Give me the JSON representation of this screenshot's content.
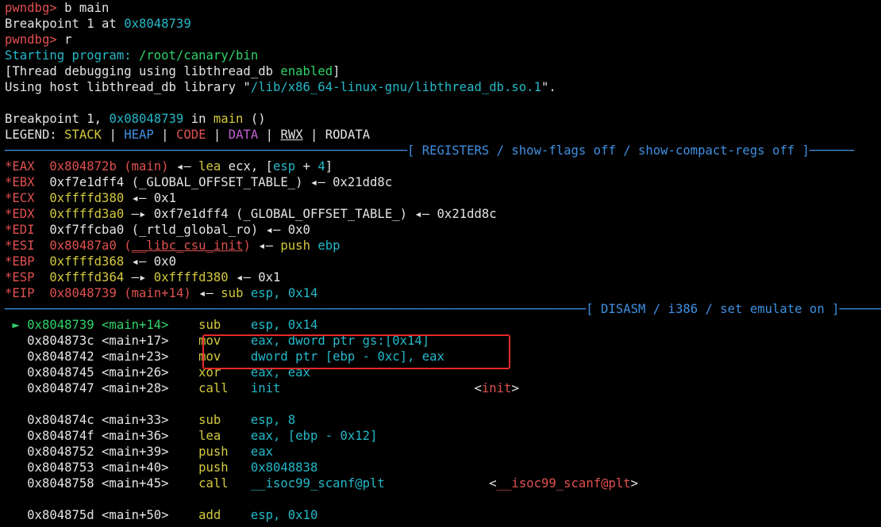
{
  "colors": {
    "background": "#000000",
    "prompt": "#e05050",
    "address": "#24b8c8",
    "code": "#d4c93e",
    "highlight_box": "#e6282a"
  },
  "lines": [
    [
      {
        "t": "pwndbg> ",
        "c": "red"
      },
      {
        "t": "b main",
        "c": "white"
      }
    ],
    [
      {
        "t": "Breakpoint 1 at ",
        "c": "white"
      },
      {
        "t": "0x8048739",
        "c": "cyan"
      }
    ],
    [
      {
        "t": "pwndbg> ",
        "c": "red"
      },
      {
        "t": "r",
        "c": "white"
      }
    ],
    [
      {
        "t": "Starting program: ",
        "c": "cyan"
      },
      {
        "t": "/root/canary/bin",
        "c": "green"
      }
    ],
    [
      {
        "t": "[Thread debugging using libthread_db ",
        "c": "white"
      },
      {
        "t": "enabled",
        "c": "green"
      },
      {
        "t": "]",
        "c": "white"
      }
    ],
    [
      {
        "t": "Using host libthread_db library \"",
        "c": "white"
      },
      {
        "t": "/lib/x86_64-linux-gnu/libthread_db.so.1",
        "c": "cyan"
      },
      {
        "t": "\".",
        "c": "white"
      }
    ],
    [],
    [
      {
        "t": "Breakpoint 1, ",
        "c": "white"
      },
      {
        "t": "0x08048739",
        "c": "cyan"
      },
      {
        "t": " in ",
        "c": "white"
      },
      {
        "t": "main",
        "c": "yellow"
      },
      {
        "t": " ()",
        "c": "white"
      }
    ],
    [
      {
        "t": "LEGEND: ",
        "c": "white"
      },
      {
        "t": "STACK",
        "c": "yellow"
      },
      {
        "t": " | ",
        "c": "white"
      },
      {
        "t": "HEAP",
        "c": "blue"
      },
      {
        "t": " | ",
        "c": "white"
      },
      {
        "t": "CODE",
        "c": "red"
      },
      {
        "t": " | ",
        "c": "white"
      },
      {
        "t": "DATA",
        "c": "magenta"
      },
      {
        "t": " | ",
        "c": "white"
      },
      {
        "t": "RWX",
        "c": "ul"
      },
      {
        "t": " | RODATA",
        "c": "white"
      }
    ],
    [
      {
        "t": "──────────────────────────────────────────────────────[ REGISTERS / show-flags off / show-compact-regs off ]──────",
        "c": "blue"
      }
    ],
    [
      {
        "t": "*EAX  ",
        "c": "red"
      },
      {
        "t": "0x804872b (main)",
        "c": "red"
      },
      {
        "t": " ◂— ",
        "c": "white"
      },
      {
        "t": "lea",
        "c": "yellow"
      },
      {
        "t": " ecx, [",
        "c": "white"
      },
      {
        "t": "esp",
        "c": "cyan"
      },
      {
        "t": " + ",
        "c": "white"
      },
      {
        "t": "4",
        "c": "cyan"
      },
      {
        "t": "]",
        "c": "white"
      }
    ],
    [
      {
        "t": "*EBX  ",
        "c": "red"
      },
      {
        "t": "0xf7e1dff4 (_GLOBAL_OFFSET_TABLE_) ◂— 0x21dd8c",
        "c": "white"
      }
    ],
    [
      {
        "t": "*ECX  ",
        "c": "red"
      },
      {
        "t": "0xffffd380",
        "c": "yellow"
      },
      {
        "t": " ◂— 0x1",
        "c": "white"
      }
    ],
    [
      {
        "t": "*EDX  ",
        "c": "red"
      },
      {
        "t": "0xffffd3a0",
        "c": "yellow"
      },
      {
        "t": " —▸ 0xf7e1dff4 (_GLOBAL_OFFSET_TABLE_) ◂— 0x21dd8c",
        "c": "white"
      }
    ],
    [
      {
        "t": "*EDI  ",
        "c": "red"
      },
      {
        "t": "0xf7ffcba0 (_rtld_global_ro) ◂— 0x0",
        "c": "white"
      }
    ],
    [
      {
        "t": "*ESI  ",
        "c": "red"
      },
      {
        "t": "0x80487a0 (",
        "c": "red"
      },
      {
        "t": "__libc_csu_init",
        "c": "red",
        "u": true
      },
      {
        "t": ")",
        "c": "red"
      },
      {
        "t": " ◂— ",
        "c": "white"
      },
      {
        "t": "push",
        "c": "yellow"
      },
      {
        "t": " ebp",
        "c": "cyan"
      }
    ],
    [
      {
        "t": "*EBP  ",
        "c": "red"
      },
      {
        "t": "0xffffd368",
        "c": "yellow"
      },
      {
        "t": " ◂— 0x0",
        "c": "white"
      }
    ],
    [
      {
        "t": "*ESP  ",
        "c": "red"
      },
      {
        "t": "0xffffd364",
        "c": "yellow"
      },
      {
        "t": " —▸ ",
        "c": "white"
      },
      {
        "t": "0xffffd380",
        "c": "yellow"
      },
      {
        "t": " ◂— 0x1",
        "c": "white"
      }
    ],
    [
      {
        "t": "*EIP  ",
        "c": "red"
      },
      {
        "t": "0x8048739 (main+14)",
        "c": "red"
      },
      {
        "t": " ◂— ",
        "c": "white"
      },
      {
        "t": "sub",
        "c": "yellow"
      },
      {
        "t": " esp, ",
        "c": "cyan"
      },
      {
        "t": "0x14",
        "c": "cyan"
      }
    ],
    [
      {
        "t": "──────────────────────────────────────────────────────────────────────────────[ DISASM / i386 / set emulate on ]──────",
        "c": "blue"
      }
    ],
    [
      {
        "t": " ► 0x8048739 <main+14>    ",
        "c": "green"
      },
      {
        "t": "sub",
        "c": "yellow"
      },
      {
        "t": "    esp, ",
        "c": "cyan"
      },
      {
        "t": "0x14",
        "c": "cyan"
      }
    ],
    [
      {
        "t": "   0x804873c <main+17>    ",
        "c": "white"
      },
      {
        "t": "mov",
        "c": "yellow"
      },
      {
        "t": "    eax, dword ptr gs:[",
        "c": "cyan"
      },
      {
        "t": "0x14",
        "c": "cyan"
      },
      {
        "t": "]",
        "c": "cyan"
      }
    ],
    [
      {
        "t": "   0x8048742 <main+23>    ",
        "c": "white"
      },
      {
        "t": "mov",
        "c": "yellow"
      },
      {
        "t": "    dword ptr [ebp - ",
        "c": "cyan"
      },
      {
        "t": "0xc",
        "c": "cyan"
      },
      {
        "t": "], eax",
        "c": "cyan"
      }
    ],
    [
      {
        "t": "   0x8048745 <main+26>    ",
        "c": "white"
      },
      {
        "t": "xor",
        "c": "yellow"
      },
      {
        "t": "    eax, eax",
        "c": "cyan"
      }
    ],
    [
      {
        "t": "   0x8048747 <main+28>    ",
        "c": "white"
      },
      {
        "t": "call",
        "c": "yellow"
      },
      {
        "t": "   init",
        "c": "cyan"
      },
      {
        "t": "                          <",
        "c": "white"
      },
      {
        "t": "init",
        "c": "red"
      },
      {
        "t": ">",
        "c": "white"
      }
    ],
    [],
    [
      {
        "t": "   0x804874c <main+33>    ",
        "c": "white"
      },
      {
        "t": "sub",
        "c": "yellow"
      },
      {
        "t": "    esp, ",
        "c": "cyan"
      },
      {
        "t": "8",
        "c": "cyan"
      }
    ],
    [
      {
        "t": "   0x804874f <main+36>    ",
        "c": "white"
      },
      {
        "t": "lea",
        "c": "yellow"
      },
      {
        "t": "    eax, [ebp - ",
        "c": "cyan"
      },
      {
        "t": "0x12",
        "c": "cyan"
      },
      {
        "t": "]",
        "c": "cyan"
      }
    ],
    [
      {
        "t": "   0x8048752 <main+39>    ",
        "c": "white"
      },
      {
        "t": "push",
        "c": "yellow"
      },
      {
        "t": "   eax",
        "c": "cyan"
      }
    ],
    [
      {
        "t": "   0x8048753 <main+40>    ",
        "c": "white"
      },
      {
        "t": "push",
        "c": "yellow"
      },
      {
        "t": "   0x8048838",
        "c": "cyan"
      }
    ],
    [
      {
        "t": "   0x8048758 <main+45>    ",
        "c": "white"
      },
      {
        "t": "call",
        "c": "yellow"
      },
      {
        "t": "   __isoc99_scanf@plt",
        "c": "cyan"
      },
      {
        "t": "              <",
        "c": "white"
      },
      {
        "t": "__isoc99_scanf@plt",
        "c": "red"
      },
      {
        "t": ">",
        "c": "white"
      }
    ],
    [],
    [
      {
        "t": "   0x804875d <main+50>    ",
        "c": "white"
      },
      {
        "t": "add",
        "c": "yellow"
      },
      {
        "t": "    esp, ",
        "c": "cyan"
      },
      {
        "t": "0x10",
        "c": "cyan"
      }
    ]
  ]
}
